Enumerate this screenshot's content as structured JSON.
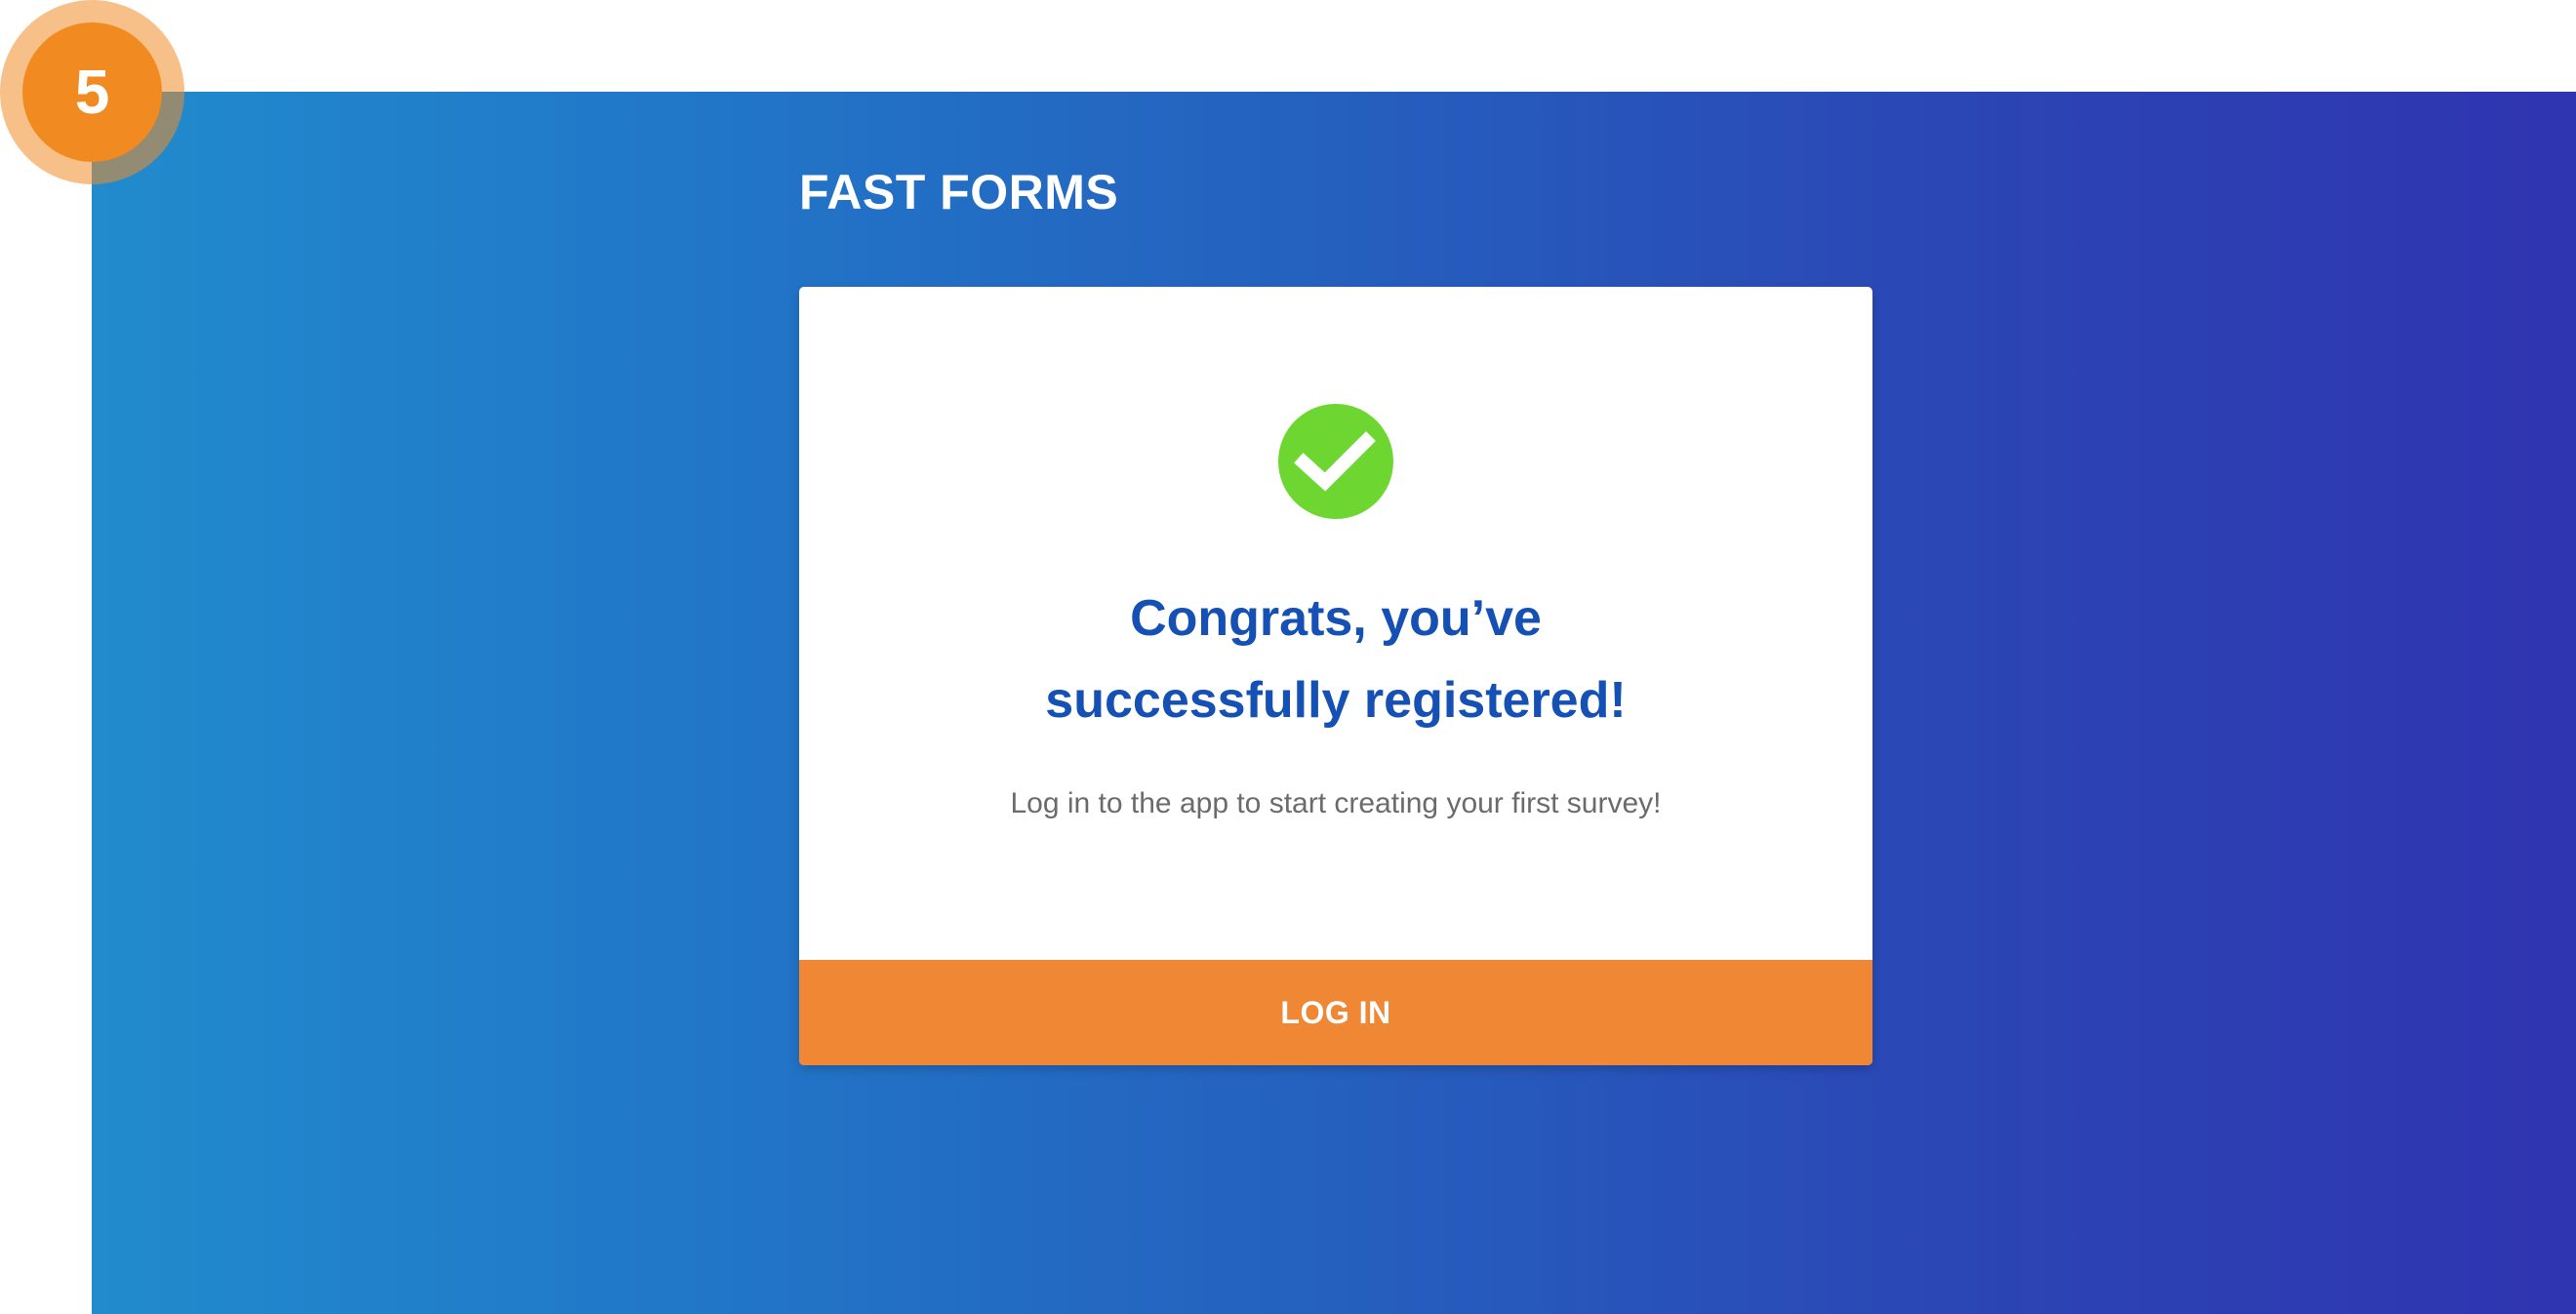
{
  "step": {
    "number": "5"
  },
  "brand": {
    "title": "FAST FORMS"
  },
  "card": {
    "icon": "check-circle-icon",
    "heading_line1": "Congrats, you’ve",
    "heading_line2": "successfully registered!",
    "subtext": "Log in to the app to start creating your first survey!",
    "button_label": "LOG IN"
  },
  "colors": {
    "gradient_start": "#218bcd",
    "gradient_end": "#2f34b0",
    "heading": "#1550b4",
    "success": "#6dd631",
    "button": "#ef8734",
    "badge": "#f28a22"
  }
}
